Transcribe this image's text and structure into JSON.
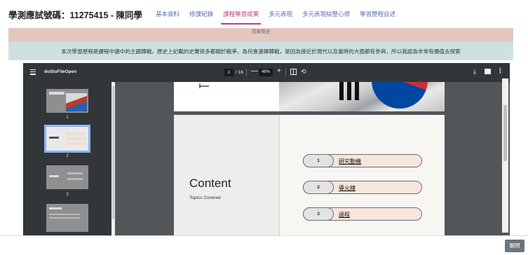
{
  "header": {
    "student_label": "學測應試號碼：11275415 - 陳同學",
    "tabs": [
      {
        "label": "基本資料"
      },
      {
        "label": "修課紀錄"
      },
      {
        "label": "課程學習成果",
        "active": true
      },
      {
        "label": "多元表現"
      },
      {
        "label": "多元表現綜整心得"
      },
      {
        "label": "學習歷程自述"
      }
    ]
  },
  "banners": {
    "pink_text": "成果簡述",
    "blue_text": "本次學習歷程是課程中選中的主題韓戰，歷史上記載的史實很多都關於戰爭，為何會選擇韓戰，是因為接近於現代以及當時的大國都有參與，所以我認為非常有價值去探索"
  },
  "viewer": {
    "title": "doStuFileOpen",
    "page_current": "2",
    "page_total": "/ 16",
    "zoom": "46%",
    "zoom_minus": "—",
    "zoom_plus": "+",
    "thumbnails": [
      {
        "number": "1"
      },
      {
        "number": "2",
        "selected": true
      },
      {
        "number": "3"
      }
    ],
    "slide": {
      "title": "Content",
      "subtitle": "Topics Covered",
      "items": [
        {
          "num": "1",
          "label": "研究動機"
        },
        {
          "num": "2",
          "label": "導火線"
        },
        {
          "num": "3",
          "label": "過程"
        }
      ]
    }
  },
  "footer": {
    "close_label": "關閉"
  },
  "colors": {
    "accent": "#c23c7e",
    "tab": "#5a6fb8",
    "pink_banner": "#e4c7c1",
    "blue_banner": "#cfe0e3",
    "viewer_toolbar": "#323639",
    "close_button": "#6c757d"
  },
  "icons": [
    "menu-icon",
    "fit-page-icon",
    "rotate-icon",
    "download-icon",
    "print-icon",
    "more-options-icon"
  ]
}
